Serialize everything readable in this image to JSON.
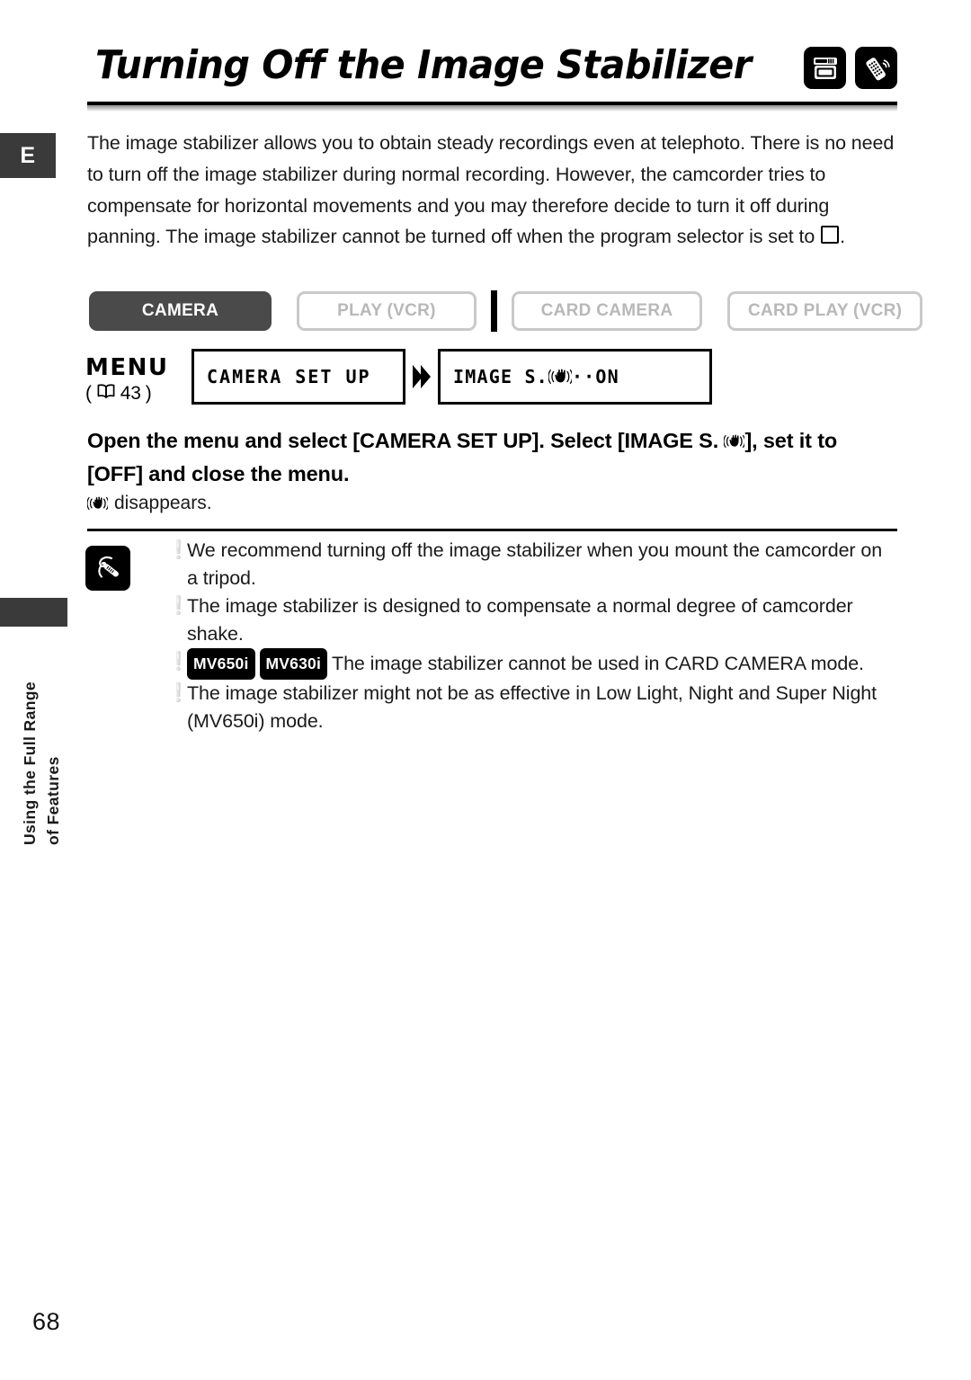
{
  "page": {
    "title": "Turning Off the Image Stabilizer",
    "language_tab": "E",
    "page_number": "68",
    "side_tab_line1": "Using the Full Range",
    "side_tab_line2": "of Features",
    "header_icons": [
      "camcorder-icon",
      "remote-control-icon"
    ]
  },
  "intro": {
    "part1": "The image stabilizer allows you to obtain steady recordings even at telephoto. There is no need to turn off the image stabilizer during normal recording. However, the camcorder tries to compensate for horizontal movements and you may therefore decide to turn it off during panning. The image stabilizer cannot be turned off when the program selector is set to ",
    "part2": "."
  },
  "modes": {
    "items": [
      {
        "label": "CAMERA",
        "active": true
      },
      {
        "label": "PLAY (VCR)",
        "active": false
      },
      {
        "label": "CARD CAMERA",
        "active": false
      },
      {
        "label": "CARD PLAY (VCR)",
        "active": false
      }
    ]
  },
  "menu": {
    "menu_word": "MENU",
    "reference_open": "(",
    "reference_page": "43",
    "reference_close": ")",
    "box1": "CAMERA SET UP",
    "box2_prefix": "IMAGE S. ",
    "box2_suffix": "··ON"
  },
  "instruction": {
    "line_a": "Open the menu and select [CAMERA SET UP]. Select [IMAGE S. ",
    "line_b": "], set it to [OFF] and close the menu.",
    "sub_note": "disappears."
  },
  "notes": {
    "items": [
      {
        "bullet": "❕",
        "text": "We recommend turning off the image stabilizer when you mount the camcorder on a tripod."
      },
      {
        "bullet": "❕",
        "text": "The image stabilizer is designed to compensate a normal degree of camcorder shake."
      },
      {
        "bullet": "❕",
        "badges": [
          "MV650i",
          "MV630i"
        ],
        "text": "The image stabilizer cannot be used in CARD CAMERA mode."
      },
      {
        "bullet": "❕",
        "text": "The image stabilizer might not be as effective in Low Light, Night and Super Night (MV650i) mode."
      }
    ]
  },
  "colors": {
    "tab_dark": "#3a3a3a",
    "pill_active_bg": "#4a4a4a",
    "pill_inactive_border": "#c9c9c9",
    "pill_inactive_text": "#b8b8b8",
    "text": "#1a1a1a"
  }
}
